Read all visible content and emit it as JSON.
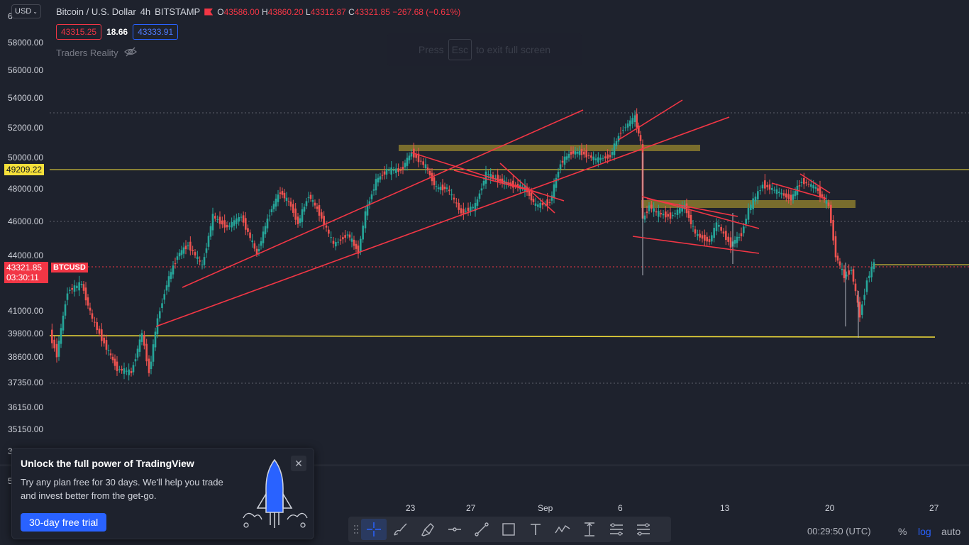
{
  "header": {
    "currency": "USD",
    "symbol_title": "Bitcoin / U.S. Dollar",
    "interval": "4h",
    "exchange": "BITSTAMP",
    "ohlc": {
      "o_label": "O",
      "o": "43586.00",
      "h_label": "H",
      "h": "43860.20",
      "l_label": "L",
      "l": "43312.87",
      "c_label": "C",
      "c": "43321.85",
      "change": "−267.68 (−0.61%)"
    },
    "bid": "43315.25",
    "spread": "18.66",
    "ask": "43333.91",
    "indicator_name": "Traders Reality"
  },
  "fullscreen_hint": {
    "press": "Press",
    "key": "Esc",
    "rest": "to exit full screen"
  },
  "price_axis": {
    "labels": [
      "58000.00",
      "56000.00",
      "54000.00",
      "52000.00",
      "50000.00",
      "48000.00",
      "46000.00",
      "44000.00",
      "41000.00",
      "39800.00",
      "38600.00",
      "37350.00",
      "36150.00",
      "35150.00"
    ],
    "partial_top": "6",
    "partial_bottom": "3",
    "partial_low": "5"
  },
  "price_tags": {
    "horizontal_line": "49209.22",
    "current_price": "43321.85",
    "countdown": "03:30:11",
    "symbol": "BTCUSD"
  },
  "time_axis": {
    "labels": [
      "23",
      "27",
      "Sep",
      "6",
      "13",
      "20",
      "27"
    ]
  },
  "bottom_bar": {
    "clock": "00:29:50 (UTC)",
    "percent": "%",
    "log": "log",
    "auto": "auto"
  },
  "drawing_tools": [
    "crosshair-tool",
    "brush-tool",
    "highlighter-tool",
    "horizontal-ray-tool",
    "trendline-tool",
    "rectangle-tool",
    "text-tool",
    "path-tool",
    "price-range-tool",
    "long-position-tool",
    "short-position-tool"
  ],
  "promo": {
    "title": "Unlock the full power of TradingView",
    "body": "Try any plan free for 30 days. We'll help you trade and invest better from the get-go.",
    "cta": "30-day free trial"
  },
  "colors": {
    "background": "#1e222d",
    "bull": "#26a69a",
    "bear": "#ef5350",
    "trendline": "#f23645",
    "hline": "#f5e03a",
    "zone": "#8a7a2e",
    "accent": "#2962ff"
  }
}
